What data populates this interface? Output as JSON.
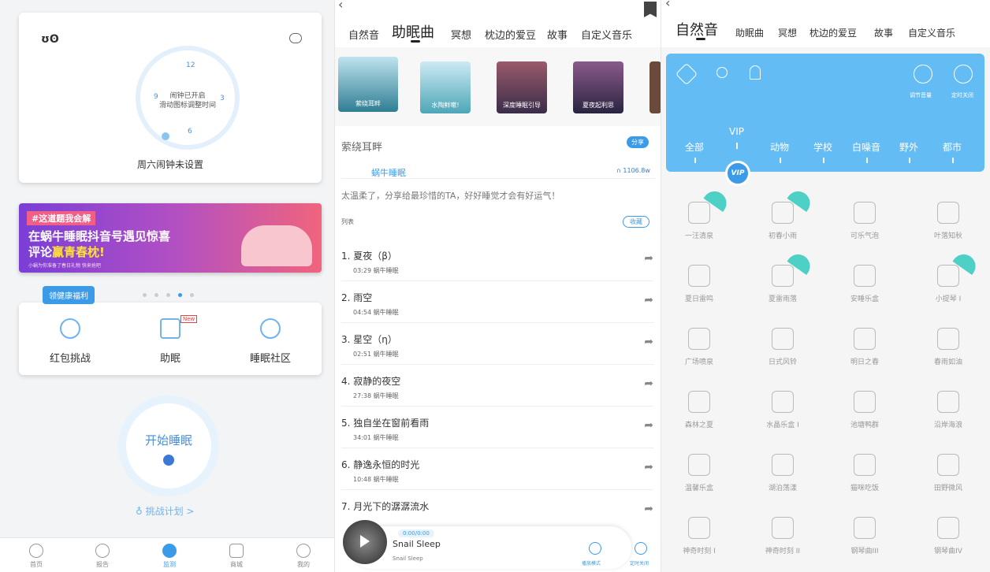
{
  "home": {
    "alarm": {
      "num12": "12",
      "num3": "3",
      "num6": "6",
      "num9": "9",
      "line1": "闹钟已开启",
      "line2": "滑动图标调整时间",
      "status": "周六闹钟未设置"
    },
    "banner": {
      "hashtag": "#这道题我会解",
      "line1": "在蜗牛睡眠抖音号遇见惊喜",
      "line2a": "评论",
      "line2b": "赢青春枕!",
      "small": "小蜗为你准备了春日礼物 快来抢吧"
    },
    "welfare_badge": "领健康福利",
    "features": [
      {
        "label": "红包挑战"
      },
      {
        "label": "助眠",
        "badge": "New"
      },
      {
        "label": "睡眠社区"
      }
    ],
    "start_label": "开始睡眠",
    "plan_link": "挑战计划 >",
    "tabs": [
      "首页",
      "报告",
      "监测",
      "商城",
      "我的"
    ],
    "active_color": "#3b9be8"
  },
  "sleep": {
    "tabs": [
      "自然音",
      "助眠曲",
      "冥想",
      "枕边的爱豆",
      "故事",
      "自定义音乐"
    ],
    "active_tab": "助眠曲",
    "albums": [
      "萦绕耳畔",
      "水陶鲜嗽!",
      "深度睡眠引导",
      "夏夜起利思"
    ],
    "playlist_title": "萦绕耳畔",
    "share": "分享",
    "author": "蜗牛睡眠",
    "plays": "1106.8w",
    "desc": "太温柔了，分享给最珍惜的TA，好好睡觉才会有好运气！",
    "list_label": "列表",
    "collect": "收藏",
    "songs": [
      {
        "title": "1. 夏夜（β）",
        "meta": "03:29  蜗牛睡眠"
      },
      {
        "title": "2. 雨空",
        "meta": "04:54  蜗牛睡眠"
      },
      {
        "title": "3. 星空（η）",
        "meta": "02:51  蜗牛睡眠"
      },
      {
        "title": "4. 寂静的夜空",
        "meta": "27:38  蜗牛睡眠"
      },
      {
        "title": "5. 独自坐在窗前看雨",
        "meta": "34:01  蜗牛睡眠"
      },
      {
        "title": "6. 静逸永恒的时光",
        "meta": "10:48  蜗牛睡眠"
      },
      {
        "title": "7. 月光下的潺潺流水",
        "meta": ""
      }
    ],
    "player": {
      "time": "0:00/0:00",
      "title": "Snail Sleep",
      "subtitle": "Snail Sleep",
      "mode": "播放模式",
      "timer": "定时关闭"
    }
  },
  "nature": {
    "tabs": [
      "自然音",
      "助眠曲",
      "冥想",
      "枕边的爱豆",
      "故事",
      "自定义音乐"
    ],
    "active_tab": "自然音",
    "volume": "调节音量",
    "timer": "定时关闭",
    "vip": "VIP",
    "vip_badge": "VIP",
    "categories": [
      "全部",
      "VIP",
      "动物",
      "学校",
      "白噪音",
      "野外",
      "都市"
    ],
    "sounds": [
      "一汪清泉",
      "初春小雨",
      "可乐气泡",
      "叶落知秋",
      "夏日雷鸣",
      "夏雷雨落",
      "安睡乐盒",
      "小提琴 I",
      "广场喷泉",
      "日式风铃",
      "明日之春",
      "春雨如油",
      "森林之夏",
      "水晶乐盒 I",
      "池塘鸭群",
      "沿岸海浪",
      "温馨乐盒",
      "湖泊荡漾",
      "猫咪吃饭",
      "田野微风",
      "神奇时刻 I",
      "神奇时刻 II",
      "钢琴曲III",
      "钢琴曲IV"
    ],
    "vip_sounds": [
      0,
      1,
      5,
      7
    ],
    "accent": "#64bcf5"
  }
}
